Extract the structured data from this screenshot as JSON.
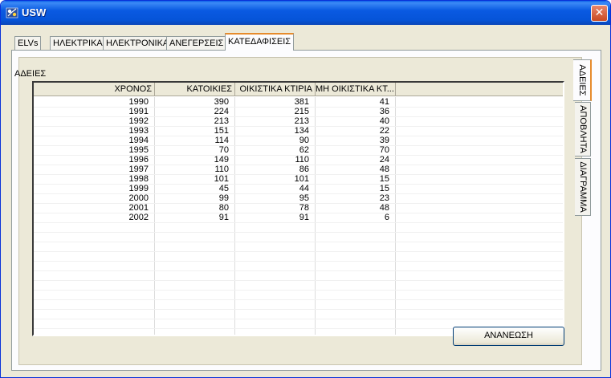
{
  "window": {
    "title": "USW",
    "close_label": "✕"
  },
  "tabs": [
    {
      "label": "ELVs",
      "active": false
    },
    {
      "label": "ΗΛΕΚΤΡΙΚΑ",
      "active": false
    },
    {
      "label": "ΗΛΕΚΤΡΟΝΙΚΑ",
      "active": false
    },
    {
      "label": "ΑΝΕΓΕΡΣΕΙΣ",
      "active": false
    },
    {
      "label": "ΚΑΤΕΔΑΦΙΣΕΙΣ",
      "active": true
    }
  ],
  "side_tabs": [
    {
      "label": "ΑΔΕΙΕΣ",
      "active": true
    },
    {
      "label": "ΑΠΟΒΛΗΤΑ",
      "active": false
    },
    {
      "label": "ΔΙΑΓΡΑΜΜΑ",
      "active": false
    }
  ],
  "group_label": "ΑΔΕΙΕΣ",
  "grid": {
    "columns": [
      "ΧΡΟΝΟΣ",
      "ΚΑΤΟΙΚΙΕΣ",
      "ΟΙΚΙΣΤΙΚΑ ΚΤΙΡΙΑ",
      "ΜΗ ΟΙΚΙΣΤΙΚΑ ΚΤ..."
    ],
    "rows": [
      [
        "1990",
        "390",
        "381",
        "41"
      ],
      [
        "1991",
        "224",
        "215",
        "36"
      ],
      [
        "1992",
        "213",
        "213",
        "40"
      ],
      [
        "1993",
        "151",
        "134",
        "22"
      ],
      [
        "1994",
        "114",
        "90",
        "39"
      ],
      [
        "1995",
        "70",
        "62",
        "70"
      ],
      [
        "1996",
        "149",
        "110",
        "24"
      ],
      [
        "1997",
        "110",
        "86",
        "48"
      ],
      [
        "1998",
        "101",
        "101",
        "15"
      ],
      [
        "1999",
        "45",
        "44",
        "15"
      ],
      [
        "2000",
        "99",
        "95",
        "23"
      ],
      [
        "2001",
        "80",
        "78",
        "48"
      ],
      [
        "2002",
        "91",
        "91",
        "6"
      ]
    ]
  },
  "refresh_button": "ΑΝΑΝΕΩΣΗ"
}
